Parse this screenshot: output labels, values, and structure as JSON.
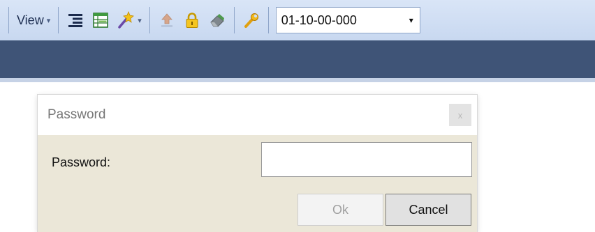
{
  "toolbar": {
    "view_label": "View",
    "view_caret": "▾",
    "wand_caret": "▾",
    "icons": [
      "align-icon",
      "grid-icon",
      "magic-wand-icon",
      "upload-icon",
      "lock-icon",
      "eraser-icon",
      "wrench-icon"
    ],
    "combo_value": "01-10-00-000",
    "combo_arrow": "▾"
  },
  "dialog": {
    "title": "Password",
    "close_glyph": "x",
    "password_label": "Password:",
    "password_value": "",
    "ok_label": "Ok",
    "cancel_label": "Cancel"
  },
  "colors": {
    "toolbar_bg": "#d0def3",
    "band": "#3f5477",
    "dialog_bg": "#ebe7d8"
  }
}
